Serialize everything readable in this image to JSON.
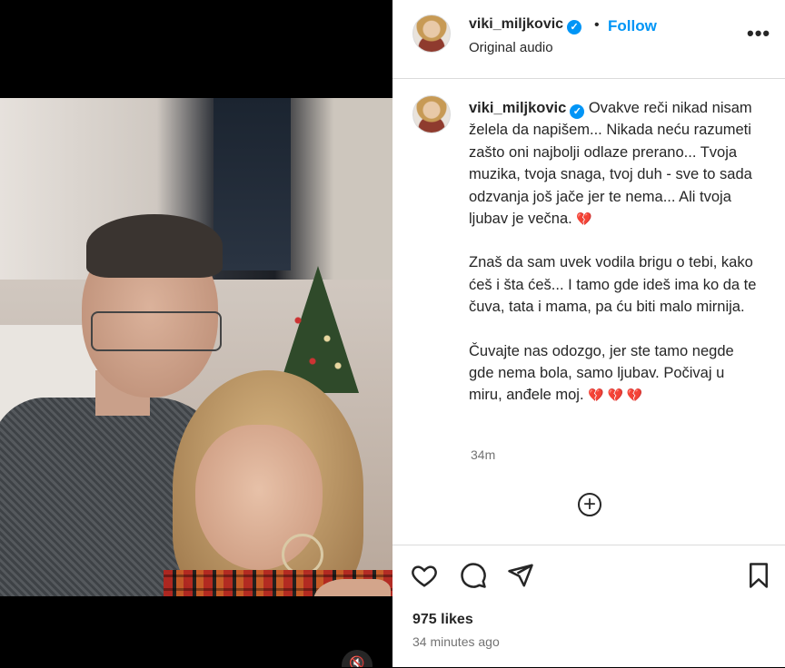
{
  "post": {
    "username": "viki_miljkovic",
    "verified_mark": "✓",
    "dot": "•",
    "follow_label": "Follow",
    "audio_label": "Original audio",
    "more_label": "•••",
    "caption_paragraphs": [
      "Ovakve reči nikad nisam želela da napišem... Nikada neću razumeti zašto oni najbolji odlaze prerano... Tvoja muzika, tvoja snaga, tvoj duh - sve to sada odzvanja još jače jer te nema... Ali tvoja ljubav je večna.",
      "Znaš da sam uvek vodila brigu o tebi, kako ćeš i šta ćeš... I tamo gde ideš ima ko da te čuva, tata i mama, pa ću biti malo mirnija.",
      "Čuvajte nas odozgo, jer ste tamo negde gde nema bola, samo ljubav. Počivaj u miru, anđele moj."
    ],
    "heart_broken": "💔",
    "heart_triple": "💔 💔 💔",
    "caption_time": "34m",
    "add_comment_symbol": "+",
    "likes": "975 likes",
    "posted_time": "34 minutes ago"
  },
  "media": {
    "mute_symbol": "🔇"
  },
  "icons": {
    "like": "heart-icon",
    "comment": "comment-icon",
    "share": "share-icon",
    "save": "bookmark-icon",
    "mute": "muted-speaker-icon",
    "more": "more-options-icon",
    "add": "add-comment-icon"
  },
  "colors": {
    "accent": "#0095f6",
    "text": "#262626",
    "secondary": "#737373",
    "border": "#dbdbdb",
    "broken_heart": "#e0245e"
  }
}
